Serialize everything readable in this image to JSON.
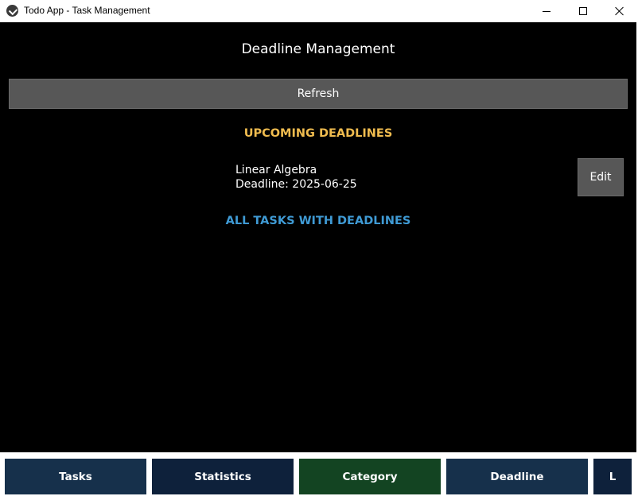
{
  "window": {
    "title": "Todo App - Task Management"
  },
  "page": {
    "title": "Deadline Management",
    "refresh_label": "Refresh"
  },
  "upcoming": {
    "heading": "UPCOMING DEADLINES",
    "heading_color": "#f0bc4f",
    "items": [
      {
        "title": "Linear Algebra",
        "deadline": "Deadline: 2025-06-25",
        "edit_label": "Edit"
      }
    ]
  },
  "all_tasks": {
    "heading": "ALL TASKS WITH DEADLINES",
    "heading_color": "#3f9ad4"
  },
  "nav": {
    "items": [
      {
        "label": "Tasks",
        "color": "#16304b"
      },
      {
        "label": "Statistics",
        "color": "#0e213b"
      },
      {
        "label": "Category",
        "color": "#134422"
      },
      {
        "label": "Deadline",
        "color": "#16304b"
      },
      {
        "label": "L",
        "color": "#0e213b"
      }
    ]
  },
  "icons": {
    "app": "app-icon",
    "minimize": "minimize-icon",
    "maximize": "maximize-icon",
    "close": "close-icon"
  }
}
